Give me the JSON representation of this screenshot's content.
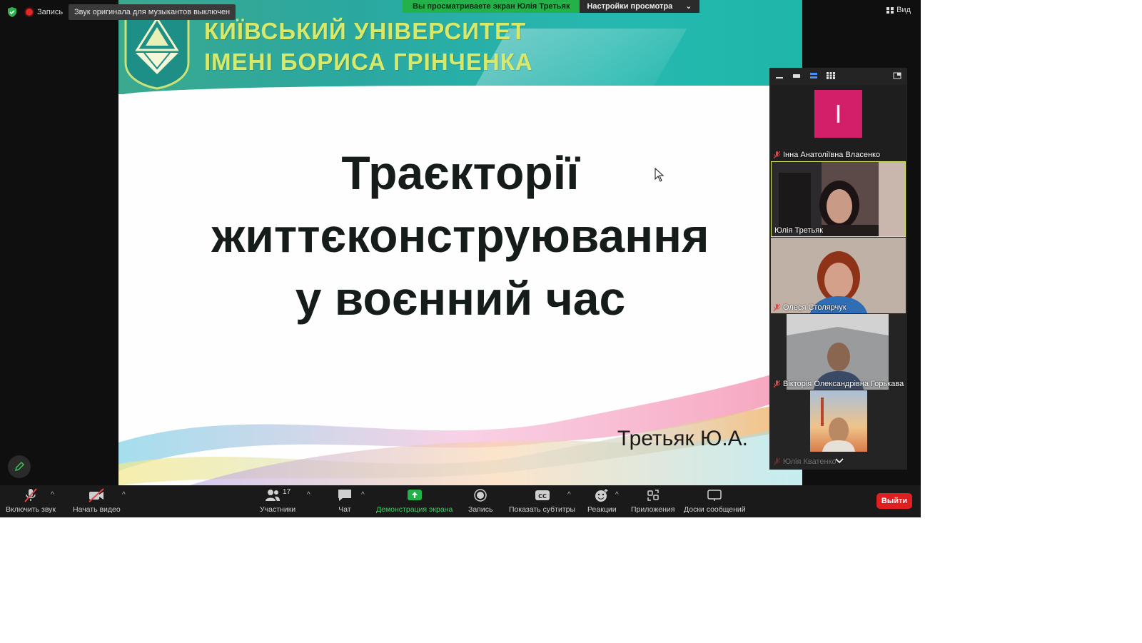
{
  "top": {
    "recording_label": "Запись",
    "sound_note": "Звук оригинала для музыкантов выключен",
    "share_banner": "Вы просматриваете экран Юлія Третьяк",
    "view_settings": "Настройки просмотра",
    "view_label": "Вид"
  },
  "slide": {
    "university_line1": "КИЇВСЬКИЙ УНІВЕРСИТЕТ",
    "university_line2": "ІМЕНІ БОРИСА ГРІНЧЕНКА",
    "title_line1": "Траєкторії",
    "title_line2": "життєконструювання",
    "title_line3": "у воєнний час",
    "author": "Третьяк Ю.А."
  },
  "gallery": {
    "participants": [
      {
        "name": "Інна Анатоліївна Власенко",
        "initial": "I",
        "muted": true
      },
      {
        "name": "Юлія Третьяк",
        "muted": false
      },
      {
        "name": "Олеся Столярчук",
        "muted": true
      },
      {
        "name": "Вікторія Олександрівна Горькава",
        "muted": true
      },
      {
        "name": "Юлія Кватенко",
        "muted": true
      }
    ]
  },
  "toolbar": {
    "unmute": "Включить звук",
    "start_video": "Начать видео",
    "participants": "Участники",
    "participants_count": "17",
    "chat": "Чат",
    "share_screen": "Демонстрация экрана",
    "record": "Запись",
    "captions": "Показать субтитры",
    "reactions": "Реакции",
    "apps": "Приложения",
    "whiteboards": "Доски сообщений",
    "leave": "Выйти"
  },
  "colors": {
    "share_green": "#25b14a",
    "leave_red": "#e02020",
    "avatar_pink": "#d31f6a",
    "uni_text": "#d8e96a"
  }
}
